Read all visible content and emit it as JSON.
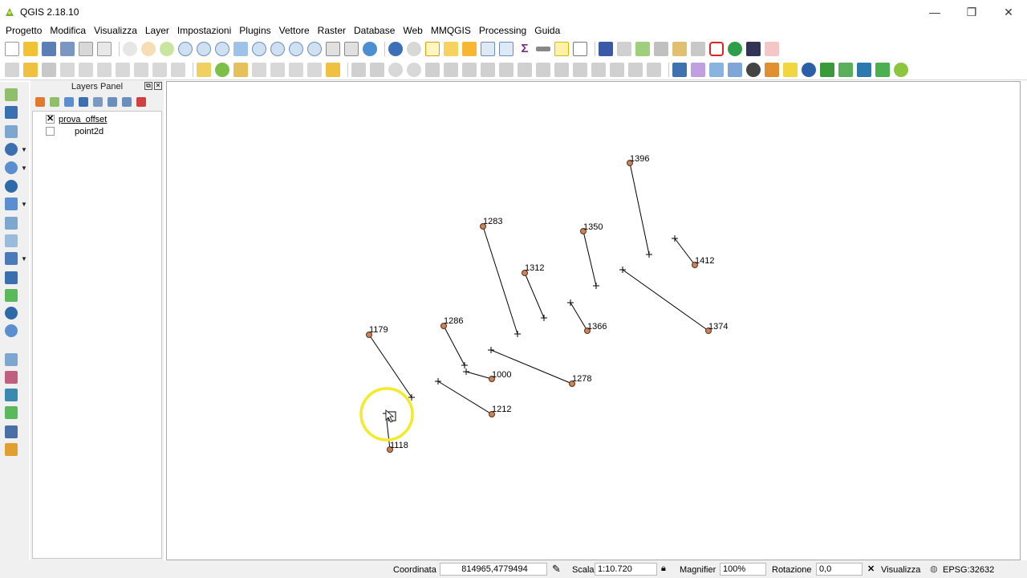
{
  "window": {
    "title": "QGIS 2.18.10",
    "controls": [
      "—",
      "❐",
      "✕"
    ]
  },
  "menu": [
    "Progetto",
    "Modifica",
    "Visualizza",
    "Layer",
    "Impostazioni",
    "Plugins",
    "Vettore",
    "Raster",
    "Database",
    "Web",
    "MMQGIS",
    "Processing",
    "Guida"
  ],
  "layers_panel": {
    "title": "Layers Panel",
    "layers": [
      {
        "name": "prova_offset",
        "checked": true
      },
      {
        "name": "point2d",
        "checked": false
      }
    ]
  },
  "map": {
    "points": [
      {
        "label": "1396"
      },
      {
        "label": "1283"
      },
      {
        "label": "1350"
      },
      {
        "label": "1412"
      },
      {
        "label": "1312"
      },
      {
        "label": "1374"
      },
      {
        "label": "1366"
      },
      {
        "label": "1179"
      },
      {
        "label": "1286"
      },
      {
        "label": "1000"
      },
      {
        "label": "1278"
      },
      {
        "label": "1212"
      },
      {
        "label": "1118"
      }
    ],
    "point_fill": "#c8835a",
    "highlight_color": "#f2ea2a"
  },
  "status": {
    "coord_label": "Coordinata",
    "coord_value": "814965,4779494",
    "scale_label": "Scala",
    "scale_value": "1:10.720",
    "magnifier_label": "Magnifier",
    "magnifier_value": "100%",
    "rotation_label": "Rotazione",
    "rotation_value": "0,0",
    "render_label": "Visualizza",
    "crs": "EPSG:32632"
  }
}
